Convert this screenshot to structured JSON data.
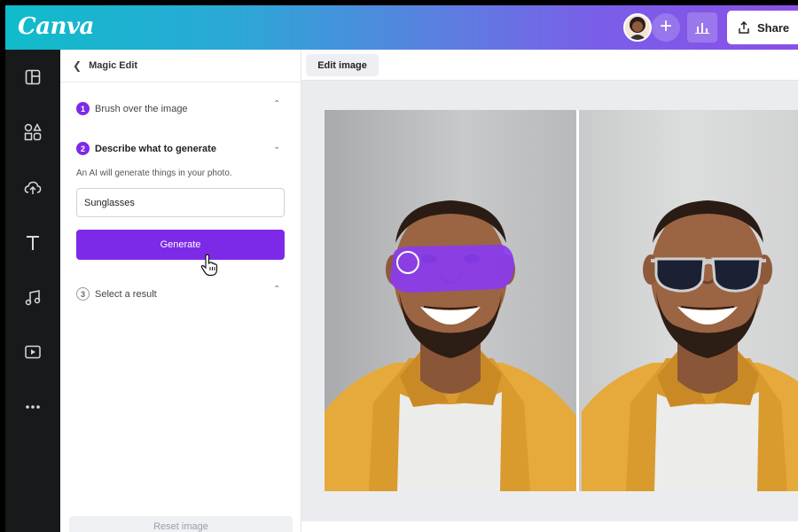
{
  "app": {
    "logo_text": "Canva",
    "brand_color": "#7d2ae8"
  },
  "header": {
    "share_label": "Share"
  },
  "rail": {
    "icons": [
      "layout-icon",
      "elements-icon",
      "upload-icon",
      "text-icon",
      "audio-icon",
      "video-icon",
      "more-icon"
    ]
  },
  "panel": {
    "title": "Magic Edit",
    "steps": [
      {
        "number": "1",
        "label": "Brush over the image"
      },
      {
        "number": "2",
        "label": "Describe what to generate"
      },
      {
        "number": "3",
        "label": "Select a result"
      }
    ],
    "description": "An AI will generate things in your photo.",
    "prompt_value": "Sunglasses",
    "generate_label": "Generate",
    "reset_label": "Reset image"
  },
  "workspace": {
    "edit_image_label": "Edit image"
  },
  "colors": {
    "accent": "#7d2ae8",
    "rail_bg": "#18191b",
    "brush_overlay": "#8a3cf0"
  }
}
